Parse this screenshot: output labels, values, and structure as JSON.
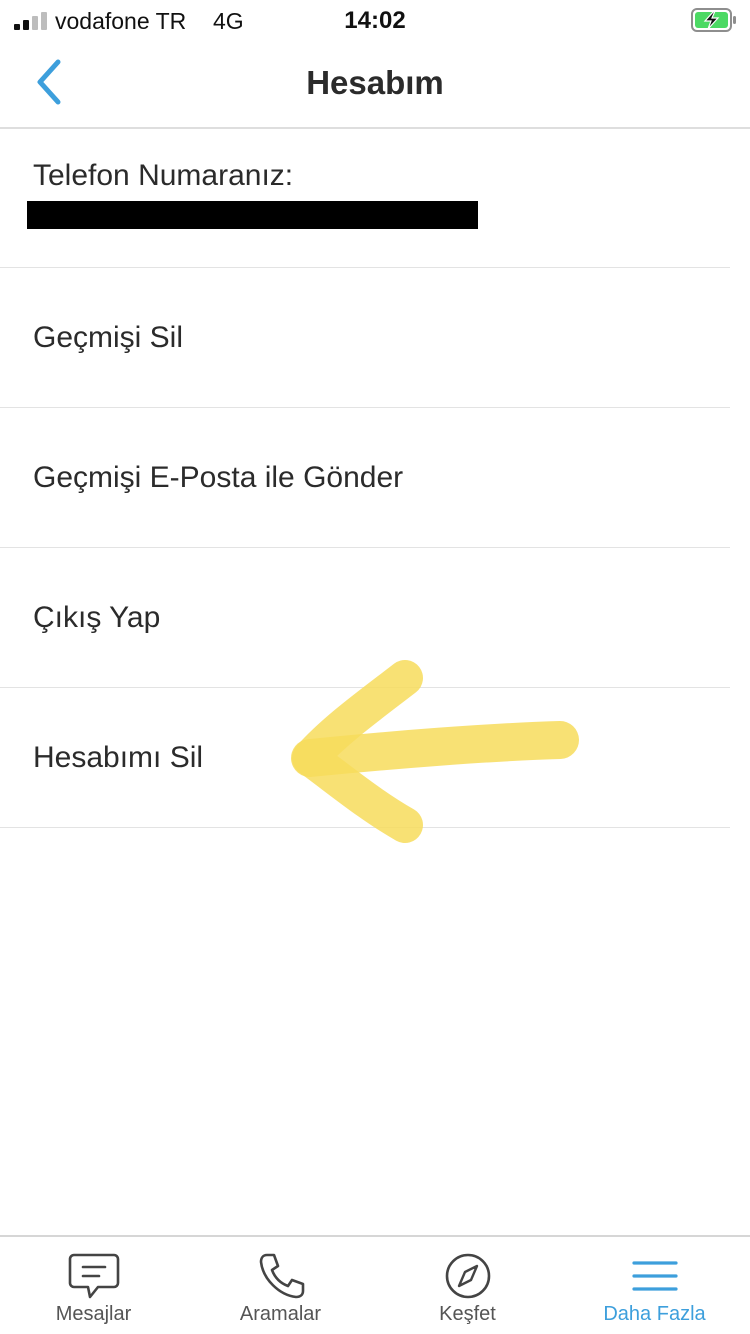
{
  "status_bar": {
    "carrier": "vodafone TR",
    "network": "4G",
    "time": "14:02"
  },
  "nav": {
    "title": "Hesabım",
    "back_icon": "chevron-left-icon"
  },
  "phone": {
    "label": "Telefon Numaranız:"
  },
  "menu": {
    "items": [
      {
        "label": "Geçmişi Sil"
      },
      {
        "label": "Geçmişi E-Posta ile Gönder"
      },
      {
        "label": "Çıkış Yap"
      },
      {
        "label": "Hesabımı Sil"
      }
    ]
  },
  "tabs": [
    {
      "label": "Mesajlar",
      "icon": "message-icon",
      "active": false
    },
    {
      "label": "Aramalar",
      "icon": "phone-icon",
      "active": false
    },
    {
      "label": "Keşfet",
      "icon": "compass-icon",
      "active": false
    },
    {
      "label": "Daha Fazla",
      "icon": "menu-icon",
      "active": true
    }
  ],
  "colors": {
    "accent": "#3d9fdc",
    "text": "#2b2b2b",
    "annotation": "#f7dc5c",
    "battery": "#4cd964"
  }
}
